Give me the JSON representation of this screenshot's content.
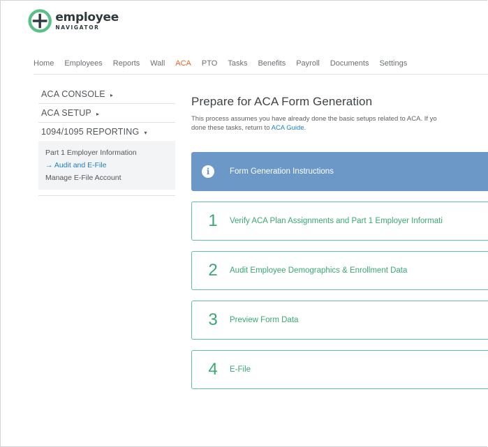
{
  "logo": {
    "word": "employee",
    "sub": "NAVIGATOR"
  },
  "nav": {
    "items": [
      {
        "label": "Home"
      },
      {
        "label": "Employees"
      },
      {
        "label": "Reports"
      },
      {
        "label": "Wall"
      },
      {
        "label": "ACA",
        "active": true
      },
      {
        "label": "PTO"
      },
      {
        "label": "Tasks"
      },
      {
        "label": "Benefits"
      },
      {
        "label": "Payroll"
      },
      {
        "label": "Documents"
      },
      {
        "label": "Settings"
      }
    ]
  },
  "sidebar": {
    "sections": [
      {
        "label": "ACA CONSOLE",
        "arrow": "▸"
      },
      {
        "label": "ACA SETUP",
        "arrow": "▸"
      },
      {
        "label": "1094/1095 REPORTING",
        "arrow": "▾"
      }
    ],
    "links": [
      {
        "label": "Part 1 Employer Information"
      },
      {
        "label": "→ Audit and E-File",
        "current": true
      },
      {
        "label": "Manage E-File Account"
      }
    ]
  },
  "main": {
    "title": "Prepare for ACA Form Generation",
    "intro_line1": "This process assumes you have already done the basic setups related to ACA. If yo",
    "intro_line2_prefix": "done these tasks, return to ",
    "intro_link": "ACA Guide",
    "intro_line2_suffix": ".",
    "info_bar": {
      "icon": "info-icon",
      "label": "Form Generation Instructions"
    },
    "steps": [
      {
        "number": "1",
        "label": "Verify ACA Plan Assignments and Part 1 Employer Informati"
      },
      {
        "number": "2",
        "label": "Audit Employee Demographics & Enrollment Data"
      },
      {
        "number": "3",
        "label": "Preview Form Data"
      },
      {
        "number": "4",
        "label": "E-File"
      }
    ]
  },
  "colors": {
    "active_nav": "#e26b2f",
    "info_bar": "#6c98c8",
    "step_green": "#3aa775",
    "link_blue": "#1f7ec0"
  }
}
